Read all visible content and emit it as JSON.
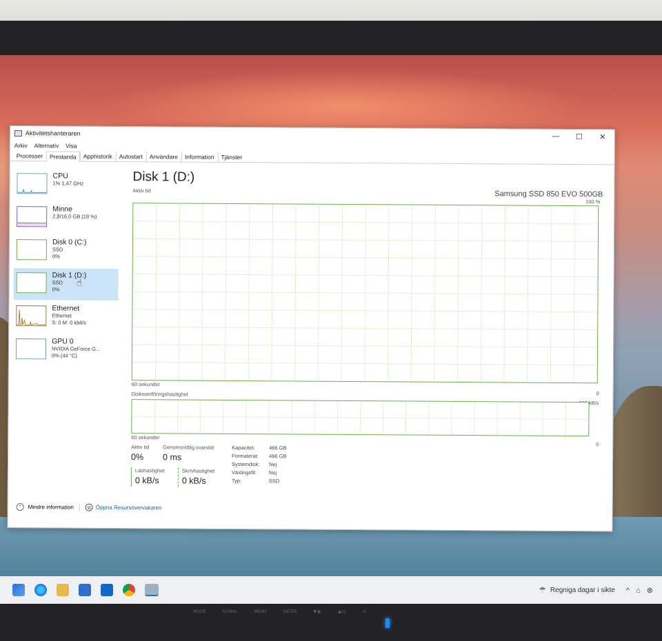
{
  "window": {
    "title": "Aktivitetshanteraren",
    "controls": {
      "minimize": "—",
      "maximize": "☐",
      "close": "✕"
    }
  },
  "menu": [
    "Arkiv",
    "Alternativ",
    "Visa"
  ],
  "tabs": [
    "Processer",
    "Prestanda",
    "Apphistorik",
    "Autostart",
    "Användare",
    "Information",
    "Tjänster"
  ],
  "active_tab": "Prestanda",
  "sidebar": {
    "items": [
      {
        "name": "CPU",
        "sub1": "1% 1,47 GHz",
        "sub2": "",
        "sub3": ""
      },
      {
        "name": "Minne",
        "sub1": "2,8/16,0 GB (18 %)",
        "sub2": "",
        "sub3": ""
      },
      {
        "name": "Disk 0 (C:)",
        "sub1": "SSD",
        "sub2": "0%",
        "sub3": ""
      },
      {
        "name": "Disk 1 (D:)",
        "sub1": "SSD",
        "sub2": "0%",
        "sub3": ""
      },
      {
        "name": "Ethernet",
        "sub1": "Ethernet",
        "sub2": "S: 0 M: 0 kbit/s",
        "sub3": ""
      },
      {
        "name": "GPU 0",
        "sub1": "NVIDIA GeForce G...",
        "sub2": "0% (44 °C)",
        "sub3": ""
      }
    ],
    "selected": "Disk 1 (D:)"
  },
  "main": {
    "title": "Disk 1 (D:)",
    "model": "Samsung SSD 850 EVO 500GB",
    "chart1": {
      "label": "Aktiv tid",
      "max": "100 %",
      "min": "0",
      "time": "60 sekunder"
    },
    "chart2": {
      "label": "Diskoverföringshastighet",
      "max": "100 kB/s",
      "min": "0",
      "time": "60 sekunder"
    },
    "stats": {
      "active_time_label": "Aktiv tid",
      "active_time": "0%",
      "response_label": "Genomsnittlig svarstid",
      "response": "0 ms",
      "read_label": "Läshastighet",
      "read": "0 kB/s",
      "write_label": "Skrivhastighet",
      "write": "0 kB/s",
      "props": [
        {
          "label": "Kapacitet:",
          "value": "466 GB"
        },
        {
          "label": "Formaterat:",
          "value": "466 GB"
        },
        {
          "label": "Systemdisk:",
          "value": "Nej"
        },
        {
          "label": "Växlingsfil:",
          "value": "Nej"
        },
        {
          "label": "Typ:",
          "value": "SSD"
        }
      ]
    }
  },
  "footer": {
    "less_info": "Mindre information",
    "resource_monitor": "Öppna Resursövervakaren"
  },
  "taskbar": {
    "news": "Regniga dagar i sikte"
  },
  "monitor": {
    "buttons": [
      "MODE",
      "SIGNAL",
      "MENU",
      "ENTER",
      "▼/◐",
      "▲/◎",
      "⏻"
    ]
  },
  "colors": {
    "disk_green": "#6cae49",
    "selected_bg": "#cce4f7",
    "link": "#1a5fb4"
  }
}
